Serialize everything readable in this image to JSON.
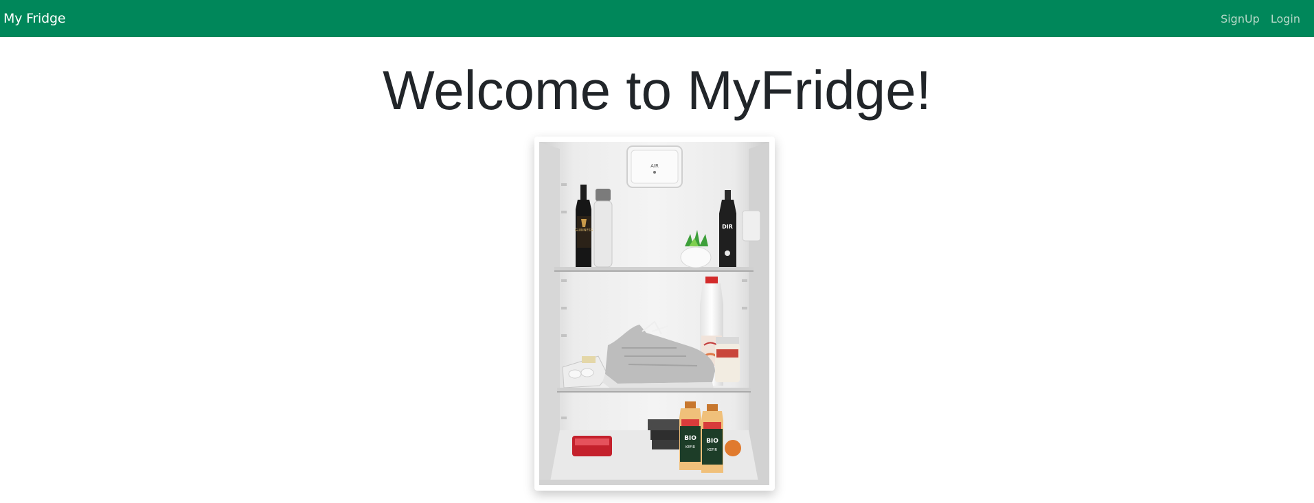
{
  "navbar": {
    "brand": "My Fridge",
    "links": [
      {
        "label": "SignUp"
      },
      {
        "label": "Login"
      }
    ],
    "background_color": "#00875a"
  },
  "hero": {
    "title": "Welcome to MyFridge!",
    "image_icon": "fridge-photo"
  },
  "photo_labels": {
    "air": "AIR",
    "bid": "BIO",
    "kefir": "KEFIR",
    "guinness": "GUINNESS",
    "dr": "DIR"
  }
}
